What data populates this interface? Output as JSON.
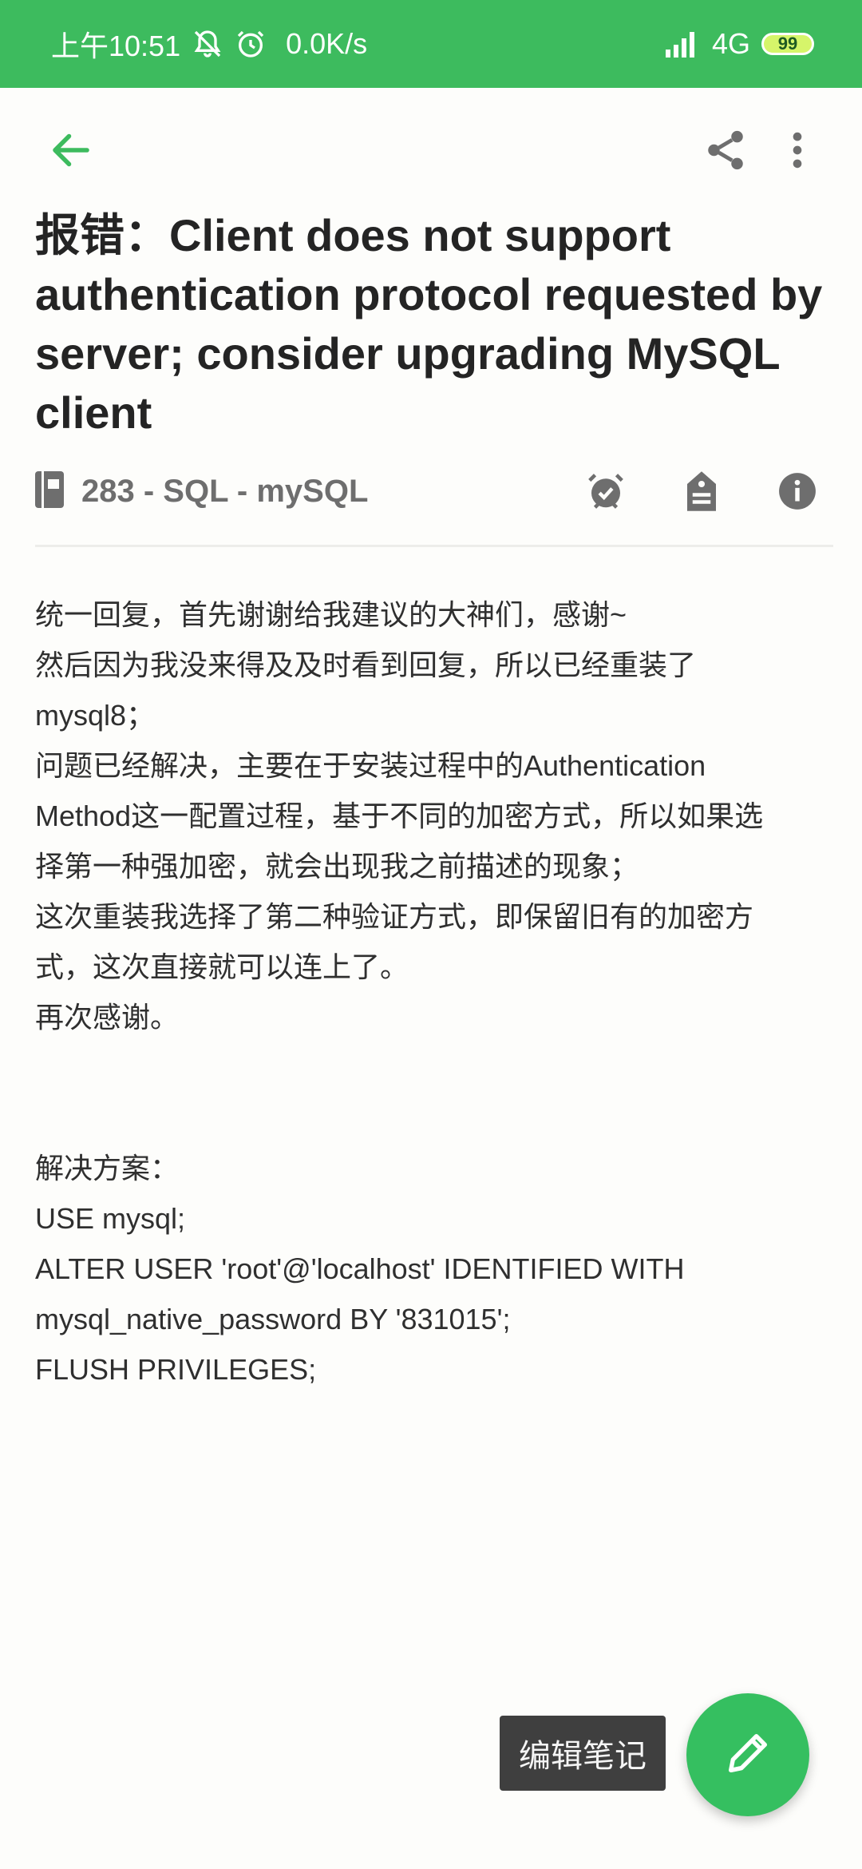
{
  "status_bar": {
    "time": "上午10:51",
    "speed": "0.0K/s",
    "network": "4G",
    "battery": "99",
    "icons": [
      "mute-icon",
      "alarm-icon",
      "signal-icon",
      "battery-icon"
    ]
  },
  "toolbar": {
    "icons": [
      "back-arrow-icon",
      "share-icon",
      "more-vert-icon"
    ]
  },
  "note": {
    "title": "报错：Client does not support authentication protocol requested by server; consider upgrading MySQL client",
    "notebook": "283 - SQL - mySQL",
    "body_lines": [
      "统一回复，首先谢谢给我建议的大神们，感谢~",
      "然后因为我没来得及及时看到回复，所以已经重装了",
      "mysql8；",
      "问题已经解决，主要在于安装过程中的Authentication",
      "Method这一配置过程，基于不同的加密方式，所以如果选",
      "择第一种强加密，就会出现我之前描述的现象；",
      "这次重装我选择了第二种验证方式，即保留旧有的加密方",
      "式，这次直接就可以连上了。",
      "再次感谢。"
    ],
    "solution_lines": [
      "解决方案：",
      "USE mysql;",
      "ALTER USER 'root'@'localhost' IDENTIFIED WITH",
      "mysql_native_password BY '831015';",
      "FLUSH PRIVILEGES;"
    ]
  },
  "edit_tooltip": "编辑笔记",
  "colors": {
    "accent": "#3dbb5e",
    "fab": "#35bf60",
    "icon_grey": "#6e6e6e"
  }
}
